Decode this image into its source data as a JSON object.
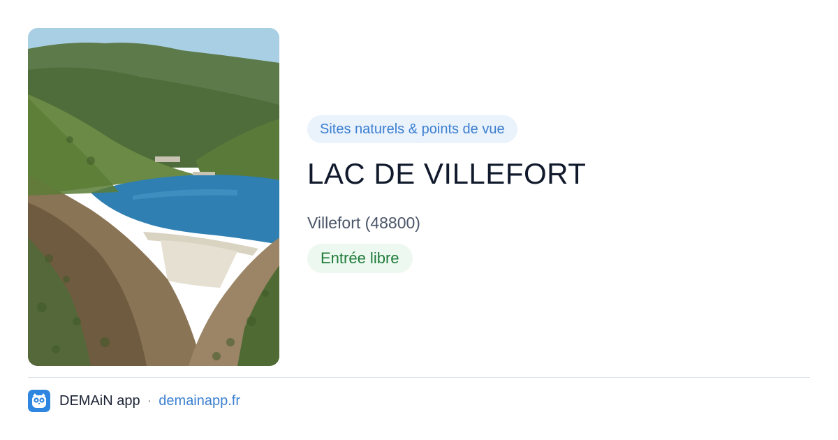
{
  "place": {
    "category": "Sites naturels & points de vue",
    "title": "LAC DE VILLEFORT",
    "location": "Villefort (48800)",
    "price": "Entrée libre"
  },
  "footer": {
    "app_name": "DEMAiN app",
    "separator": "·",
    "url": "demainapp.fr"
  },
  "icons": {
    "app_logo": "owl-logo-icon"
  },
  "colors": {
    "accent_blue": "#3b7fd0",
    "category_bg": "#eaf2fc",
    "price_green": "#1f7a3a",
    "price_bg": "#edf9f0",
    "title": "#111a2c"
  }
}
